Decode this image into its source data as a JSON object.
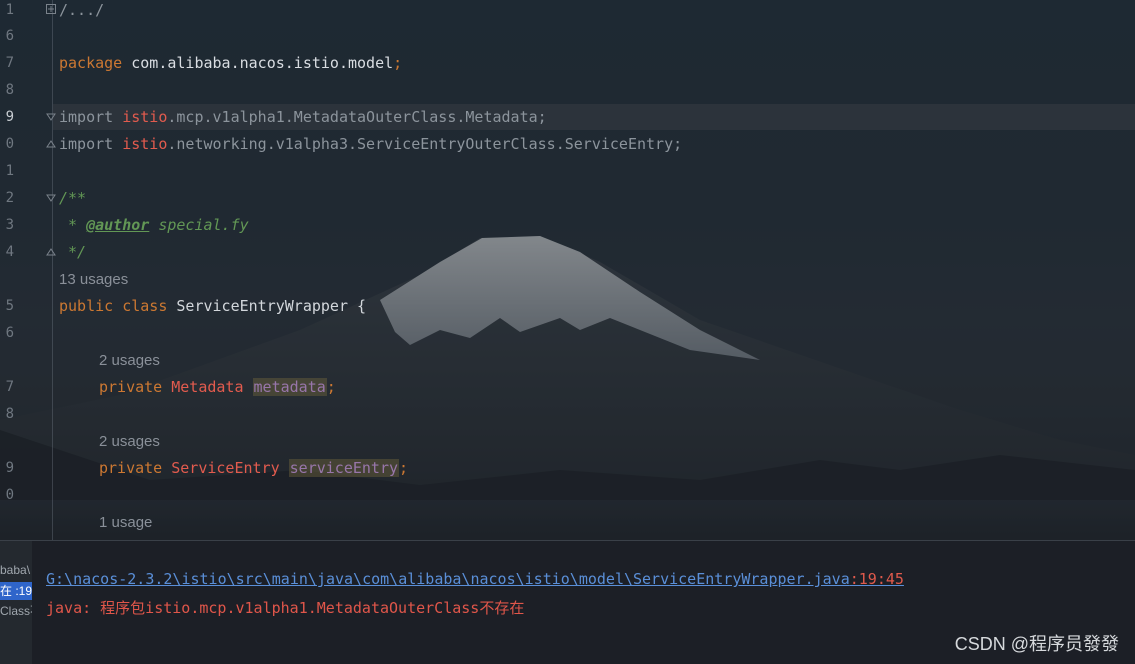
{
  "editor": {
    "line_numbers": [
      "1",
      "6",
      "7",
      "8",
      "9",
      "0",
      "1",
      "2",
      "3",
      "4",
      "5",
      "6",
      "7",
      "8",
      "9",
      "0"
    ],
    "lines": {
      "fold_import": "/.../",
      "package_kw": "package",
      "package_name": "com.alibaba.nacos.istio.model",
      "semicolon": ";",
      "import_kw": "import",
      "import1_root": "istio",
      "import1_rest": ".mcp.v1alpha1.MetadataOuterClass.Metadata;",
      "import2_root": "istio",
      "import2_rest": ".networking.v1alpha3.ServiceEntryOuterClass.ServiceEntry;",
      "doc_open": "/**",
      "doc_star": " * ",
      "doc_tag": "@author",
      "doc_author": " special.fy",
      "doc_close": " */",
      "class_usages": "13 usages",
      "public_kw": "public",
      "class_kw": "class",
      "class_name": "ServiceEntryWrapper",
      "brace": " {",
      "field1_usages": "2 usages",
      "private_kw": "private",
      "field1_type": "Metadata",
      "field1_name": "metadata",
      "field2_usages": "2 usages",
      "field2_type": "ServiceEntry",
      "field2_name": "serviceEntry",
      "field3_usages": "1 usage"
    }
  },
  "output": {
    "side_items": [
      "baba\\",
      "在 :19",
      "Class不"
    ],
    "path": "G:\\nacos-2.3.2\\istio\\src\\main\\java\\com\\alibaba\\nacos\\istio\\model\\ServiceEntryWrapper.java",
    "position": ":19:45",
    "error": "java: 程序包istio.mcp.v1alpha1.MetadataOuterClass不存在"
  },
  "watermark": "CSDN @程序员發發"
}
